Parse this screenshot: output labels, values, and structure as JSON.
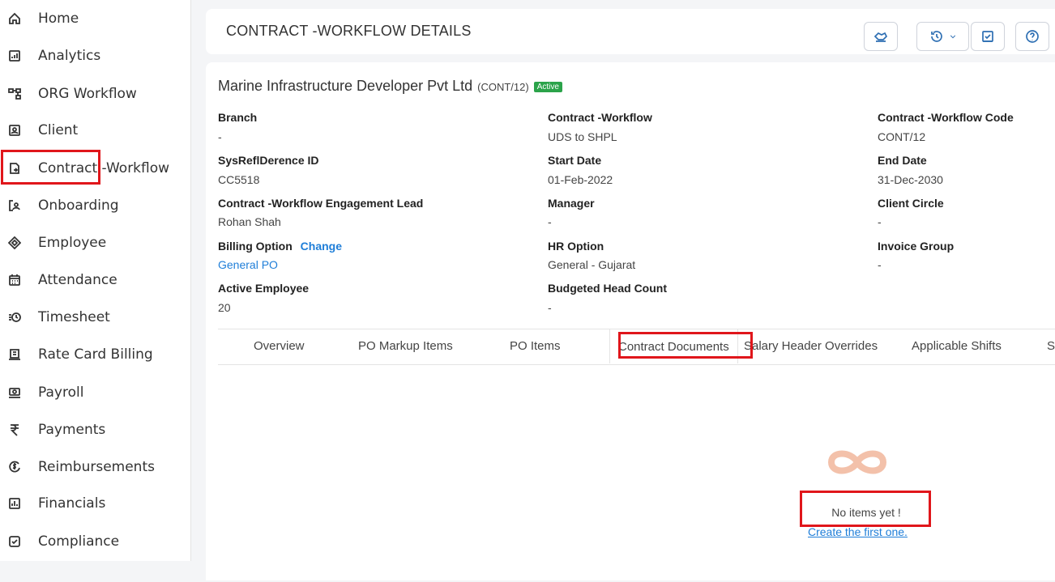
{
  "sidebar": {
    "items": [
      {
        "label": "Home",
        "icon": "home-icon"
      },
      {
        "label": "Analytics",
        "icon": "analytics-icon"
      },
      {
        "label": "ORG Workflow",
        "icon": "org-workflow-icon"
      },
      {
        "label": "Client",
        "icon": "client-icon"
      },
      {
        "label": "Contract -Workflow",
        "icon": "contract-icon"
      },
      {
        "label": "Onboarding",
        "icon": "onboarding-icon"
      },
      {
        "label": "Employee",
        "icon": "employee-icon"
      },
      {
        "label": "Attendance",
        "icon": "calendar-icon"
      },
      {
        "label": "Timesheet",
        "icon": "timesheet-icon"
      },
      {
        "label": "Rate Card Billing",
        "icon": "rate-card-icon"
      },
      {
        "label": "Payroll",
        "icon": "payroll-icon"
      },
      {
        "label": "Payments",
        "icon": "rupee-icon"
      },
      {
        "label": "Reimbursements",
        "icon": "reimbursement-icon"
      },
      {
        "label": "Financials",
        "icon": "financials-icon"
      },
      {
        "label": "Compliance",
        "icon": "compliance-icon"
      }
    ]
  },
  "header": {
    "title": "CONTRACT -WORKFLOW DETAILS"
  },
  "details": {
    "company": "Marine Infrastructure Developer Pvt Ltd",
    "code": "(CONT/12)",
    "status": "Active",
    "fields": {
      "branch": {
        "label": "Branch",
        "value": "-"
      },
      "contract_workflow": {
        "label": "Contract -Workflow",
        "value": "UDS to SHPL"
      },
      "contract_workflow_code": {
        "label": "Contract -Workflow Code",
        "value": "CONT/12"
      },
      "sys_ref_id": {
        "label": "SysReflDerence ID",
        "value": "CC5518"
      },
      "start_date": {
        "label": "Start Date",
        "value": "01-Feb-2022"
      },
      "end_date": {
        "label": "End Date",
        "value": "31-Dec-2030"
      },
      "engagement_lead": {
        "label": "Contract -Workflow Engagement Lead",
        "value": "Rohan Shah"
      },
      "manager": {
        "label": "Manager",
        "value": "-"
      },
      "client_circle": {
        "label": "Client Circle",
        "value": "-"
      },
      "billing_option": {
        "label": "Billing Option",
        "change": "Change",
        "value": "General PO"
      },
      "hr_option": {
        "label": "HR Option",
        "value": "General - Gujarat"
      },
      "invoice_group": {
        "label": "Invoice Group",
        "value": "-"
      },
      "active_employee": {
        "label": "Active Employee",
        "value": "20"
      },
      "budgeted_head_count": {
        "label": "Budgeted Head Count",
        "value": "-"
      }
    }
  },
  "tabs": [
    {
      "label": "Overview"
    },
    {
      "label": "PO Markup Items"
    },
    {
      "label": "PO Items"
    },
    {
      "label": "Contract Documents"
    },
    {
      "label": "Salary Header Overrides"
    },
    {
      "label": "Applicable Shifts"
    },
    {
      "label": "Sal"
    }
  ],
  "empty_state": {
    "message": "No items yet !",
    "action": "Create the first one."
  },
  "colors": {
    "accent": "#1f7ed8",
    "active_badge": "#2ba34a",
    "highlight": "#e0161b",
    "empty_icon": "#f3c1aa"
  }
}
